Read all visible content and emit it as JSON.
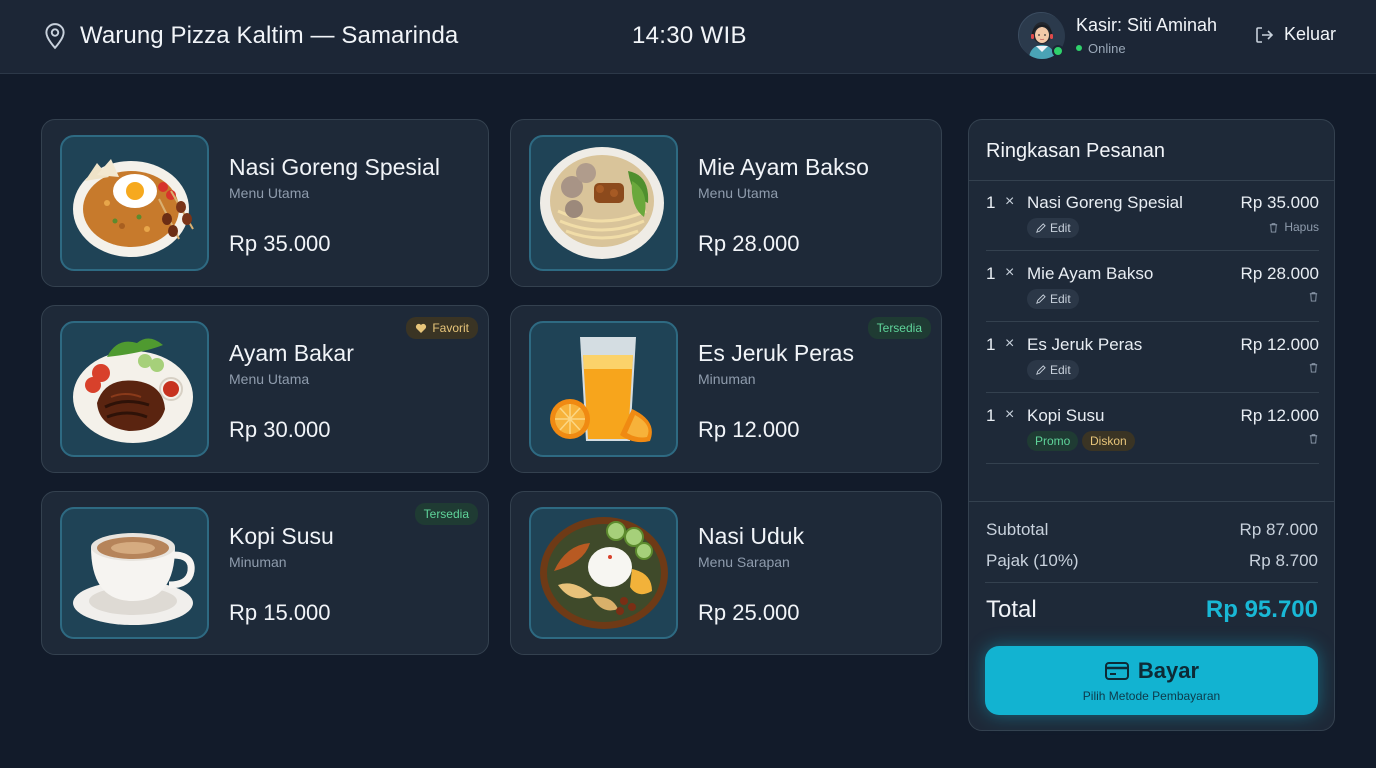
{
  "header": {
    "store_name": "Warung Pizza Kaltim — Samarinda",
    "time": "14:30 WIB",
    "cashier_name": "Kasir: Siti Aminah",
    "cashier_status": "Online",
    "logout_label": "Keluar"
  },
  "menu": [
    {
      "name": "Nasi Goreng Spesial",
      "category": "Menu Utama",
      "price": "Rp 35.000",
      "badge": "",
      "icon": "fried-rice-icon"
    },
    {
      "name": "Mie Ayam Bakso",
      "category": "Menu Utama",
      "price": "Rp 28.000",
      "badge": "",
      "icon": "noodle-bowl-icon"
    },
    {
      "name": "Ayam Bakar",
      "category": "Menu Utama",
      "price": "Rp 30.000",
      "badge": "Favorit",
      "icon": "grilled-chicken-icon"
    },
    {
      "name": "Es Jeruk Peras",
      "category": "Minuman",
      "price": "Rp 12.000",
      "badge": "Tersedia",
      "icon": "orange-juice-icon"
    },
    {
      "name": "Kopi Susu",
      "category": "Minuman",
      "price": "Rp 15.000",
      "badge": "Tersedia",
      "icon": "coffee-cup-icon"
    },
    {
      "name": "Nasi Uduk",
      "category": "Menu Sarapan",
      "price": "Rp 25.000",
      "badge": "",
      "icon": "nasi-uduk-icon"
    }
  ],
  "order": {
    "title": "Ringkasan Pesanan",
    "times_symbol": "×",
    "edit_label": "Edit",
    "delete_label": "Hapus",
    "items": [
      {
        "qty": "1",
        "name": "Nasi Goreng Spesial",
        "price": "Rp 35.000"
      },
      {
        "qty": "1",
        "name": "Mie Ayam Bakso",
        "price": "Rp 28.000"
      },
      {
        "qty": "1",
        "name": "Es Jeruk Peras",
        "price": "Rp 12.000"
      },
      {
        "qty": "1",
        "name": "Kopi Susu",
        "price": "Rp 12.000",
        "tags": [
          "Promo",
          "Diskon"
        ]
      }
    ],
    "subtotal_label": "Subtotal",
    "subtotal_value": "Rp 87.000",
    "tax_label": "Pajak (10%)",
    "tax_value": "Rp 8.700",
    "total_label": "Total",
    "total_value": "Rp 95.700",
    "pay_label": "Bayar",
    "pay_sublabel": "Pilih Metode Pembayaran"
  },
  "colors": {
    "background": "#121b2a",
    "panel": "#1e2938",
    "accent": "#12b3d1",
    "online": "#2fd16b",
    "favorite_badge": "#e7c57a",
    "available_badge": "#5fd49a"
  }
}
